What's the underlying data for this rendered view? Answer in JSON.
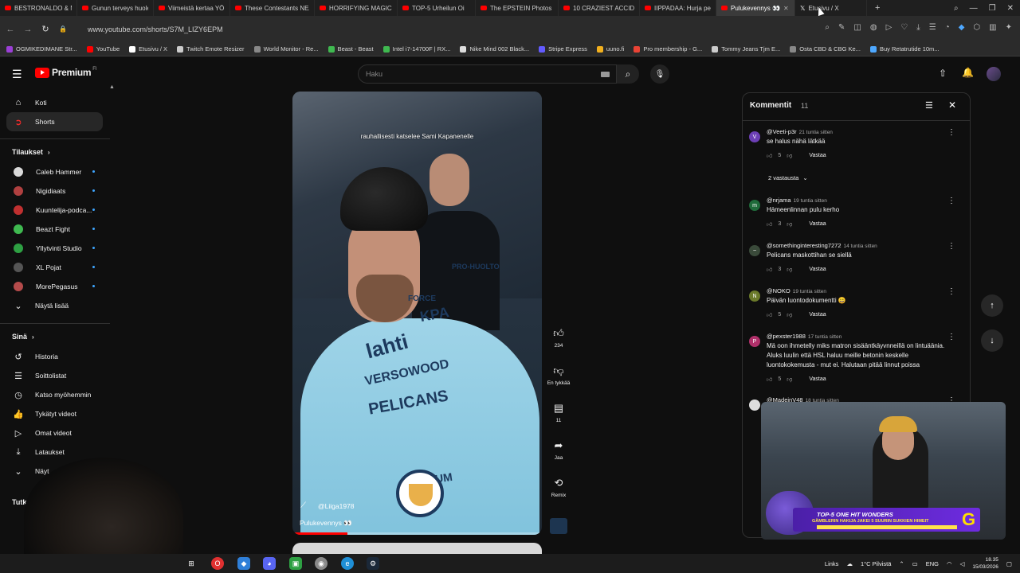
{
  "browser": {
    "tabs": [
      {
        "label": "BESTRONALDO & ME"
      },
      {
        "label": "Gunun terveys huolest"
      },
      {
        "label": "Viimeistä kertaa YÖKY"
      },
      {
        "label": "These Contestants NEA"
      },
      {
        "label": "HORRIFYING MAGIC T"
      },
      {
        "label": "TOP-5 Urheilun Oi"
      },
      {
        "label": "The EPSTEIN Photos T"
      },
      {
        "label": "10 CRAZIEST ACCIDEN"
      },
      {
        "label": "IIPPADAA: Hurja pelis"
      },
      {
        "label": "Pulukevennys 👀"
      },
      {
        "label": "Etusivu / X"
      }
    ],
    "url": "www.youtube.com/shorts/S7M_LIZY6EPM",
    "bookmarks": [
      {
        "label": "OGMIKEDIMANE Str...",
        "color": "#9b3fd6"
      },
      {
        "label": "YouTube",
        "color": "#ff0000"
      },
      {
        "label": "Etusivu / X",
        "color": "#ffffff"
      },
      {
        "label": "Twitch Emote Resizer",
        "color": "#cccccc"
      },
      {
        "label": "World Monitor - Re...",
        "color": "#888888"
      },
      {
        "label": "Beast - Beast",
        "color": "#3fb950"
      },
      {
        "label": "Intel i7-14700F | RX...",
        "color": "#3fb950"
      },
      {
        "label": "Nike Mind 002 Black...",
        "color": "#dddddd"
      },
      {
        "label": "Stripe Express",
        "color": "#635bff"
      },
      {
        "label": "uuno.fi",
        "color": "#f2b01e"
      },
      {
        "label": "Pro membership - G...",
        "color": "#ea4335"
      },
      {
        "label": "Tommy Jeans Tjm E...",
        "color": "#cccccc"
      },
      {
        "label": "Osta CBD & CBG Ke...",
        "color": "#888888"
      },
      {
        "label": "Buy Retatrutide 10m...",
        "color": "#4ea8ff"
      }
    ]
  },
  "header": {
    "logo_text": "Premium",
    "logo_sup": "FI",
    "search_placeholder": "Haku"
  },
  "sidebar": {
    "main": [
      {
        "label": "Koti",
        "icon": "home-icon",
        "glyph": "⌂"
      },
      {
        "label": "Shorts",
        "icon": "shorts-icon",
        "glyph": "➲"
      }
    ],
    "subs_heading": "Tilaukset",
    "subs": [
      {
        "label": "Caleb Hammer",
        "color": "#d9d9d9"
      },
      {
        "label": "Nigidiaats",
        "color": "#b04040"
      },
      {
        "label": "Kuuntelija-podca...",
        "color": "#c03030"
      },
      {
        "label": "Beazt Fight",
        "color": "#3fb950"
      },
      {
        "label": "Yllytvinti Studio",
        "color": "#2ea043"
      },
      {
        "label": "XL Pojat",
        "color": "#555555"
      },
      {
        "label": "MorePegasus",
        "color": "#b54b4b"
      },
      {
        "label": "Näytä lisää",
        "color": ""
      }
    ],
    "you_heading": "Sinä",
    "you": [
      {
        "label": "Historia",
        "icon": "history-icon",
        "glyph": "↺"
      },
      {
        "label": "Soittolistat",
        "icon": "playlists-icon",
        "glyph": "☰"
      },
      {
        "label": "Katso myöhemmin",
        "icon": "watch-later-icon",
        "glyph": "◷"
      },
      {
        "label": "Tykätyt videot",
        "icon": "liked-icon",
        "glyph": "👍"
      },
      {
        "label": "Omat videot",
        "icon": "your-videos-icon",
        "glyph": "▷"
      },
      {
        "label": "Lataukset",
        "icon": "downloads-icon",
        "glyph": "⤓"
      },
      {
        "label": "Näyt",
        "icon": "chevron-down-icon",
        "glyph": "⌄"
      }
    ],
    "explore_heading": "Tutk"
  },
  "video": {
    "caption": "rauhallisesti katselee Sami Kapanenelle",
    "channel": "@Liiga1978",
    "title": "Pulukevennys 👀",
    "progress": 0.22,
    "jersey_brands": [
      "lahti",
      "KPA",
      "VERSOWOOD",
      "PELICANS",
      "SPATIUM",
      "FORCE",
      "PRO-HUOLTO"
    ]
  },
  "actions": {
    "like_count": "234",
    "dislike_label": "En tykkää",
    "comments_count": "11",
    "share_label": "Jaa",
    "remix_label": "Remix"
  },
  "comments": {
    "title": "Kommentit",
    "count": "11",
    "items": [
      {
        "author": "@Veeti-p3r",
        "time": "21 tuntia sitten",
        "text": "se halus nähä lätkää",
        "likes": "5",
        "avatar": "V",
        "avatar_color": "#6c3fb5",
        "replies": "2 vastausta"
      },
      {
        "author": "@nrjama",
        "time": "19 tuntia sitten",
        "text": "Hämeenlinnan pulu kerho",
        "likes": "3",
        "avatar": "m",
        "avatar_color": "#1f6b3a",
        "replies": ""
      },
      {
        "author": "@somethinginteresting7272",
        "time": "14 tuntia sitten",
        "text": "Pelicans maskottihan se siellä",
        "likes": "3",
        "avatar": "~",
        "avatar_color": "#3a4a3a",
        "replies": ""
      },
      {
        "author": "@NOKO",
        "time": "19 tuntia sitten",
        "text": "Päivän luontodokumentti 😀",
        "likes": "5",
        "avatar": "N",
        "avatar_color": "#6b7a2a",
        "replies": ""
      },
      {
        "author": "@pexster1988",
        "time": "17 tuntia sitten",
        "text": "Mä oon ihmetelly miks matron sisääntkäyvnneillä on lintuäänia. Aluks luulin että HSL haluu meille betonin keskelle luontokokemusta - mut ei. Halutaan pitää linnut poissa",
        "likes": "5",
        "avatar": "P",
        "avatar_color": "#b0306a",
        "replies": ""
      },
      {
        "author": "@MadeinV48",
        "time": "18 tuntia sitten",
        "text": "",
        "likes": "",
        "avatar": "",
        "avatar_color": "#dddddd",
        "replies": ""
      }
    ],
    "reply_label": "Vastaa"
  },
  "stream_overlay": {
    "banner_title": "TOP-5 ONE HIT WONDERS",
    "banner_sub": "GÄMBLERIN HAKIJA JAKEI 5 SUURIN SUKKIEN HIMEIT",
    "banner_logo": "G"
  },
  "taskbar": {
    "links_label": "Links",
    "weather": "1°C Pilvistä",
    "lang": "ENG",
    "time": "18.35",
    "date": "15/03/2026"
  }
}
